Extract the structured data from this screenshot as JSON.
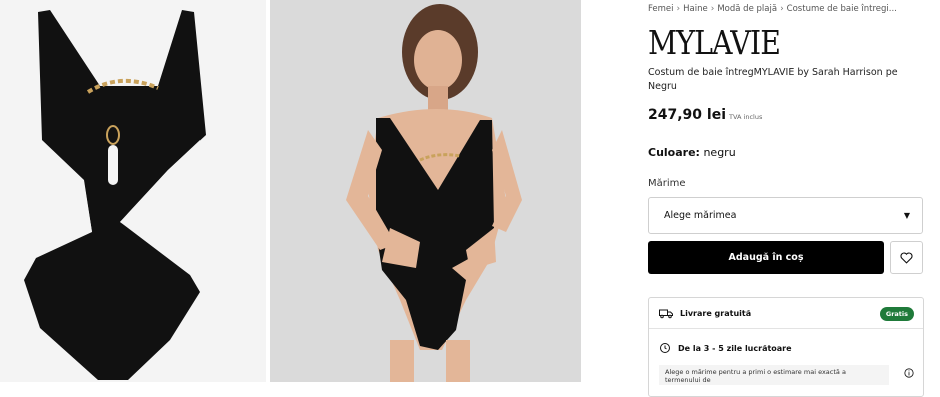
{
  "breadcrumb": [
    "Femei",
    "Haine",
    "Modă de plajă",
    "Costume de baie întregi..."
  ],
  "brand": "MYLAVIE",
  "product": {
    "name": "Costum de baie întregMYLAVIE by Sarah Harrison pe Negru",
    "price": "247,90 lei",
    "vat": "TVA inclus",
    "color_label": "Culoare:",
    "color_value": "negru"
  },
  "size": {
    "label": "Mărime",
    "placeholder": "Alege mărimea"
  },
  "actions": {
    "add_to_cart": "Adaugă în coș"
  },
  "delivery": {
    "free_label": "Livrare gratuită",
    "free_badge": "Gratis",
    "time_label": "De la 3 - 5 zile lucrătoare",
    "note": "Alege o mărime pentru a primi o estimare mai exactă a termenului de"
  },
  "colors": {
    "badge_green": "#1f7a3a",
    "button_black": "#000000"
  },
  "icons": [
    "chevron-right-icon",
    "heart-icon",
    "truck-icon",
    "clock-icon",
    "info-icon",
    "chevron-down-icon"
  ]
}
